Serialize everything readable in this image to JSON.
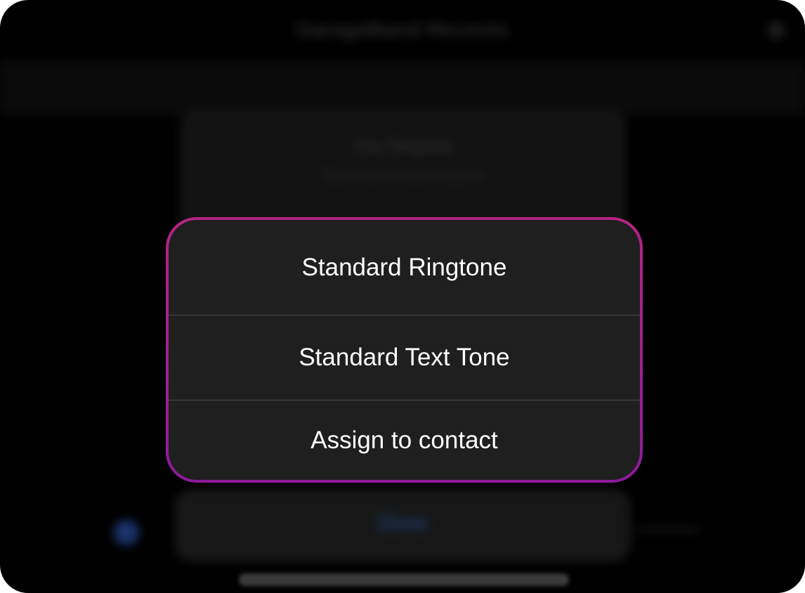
{
  "background": {
    "title": "GarageBand Recents",
    "card_title": "Your Ringtone",
    "card_subtitle": "Tap to use it as your ringtone",
    "done_label": "Done"
  },
  "action_sheet": {
    "options": [
      {
        "label": "Standard Ringtone"
      },
      {
        "label": "Standard Text Tone"
      },
      {
        "label": "Assign to contact"
      }
    ],
    "border_gradient": [
      "#b62384",
      "#8e1a9c"
    ],
    "background_color": "#1f1f1f"
  }
}
